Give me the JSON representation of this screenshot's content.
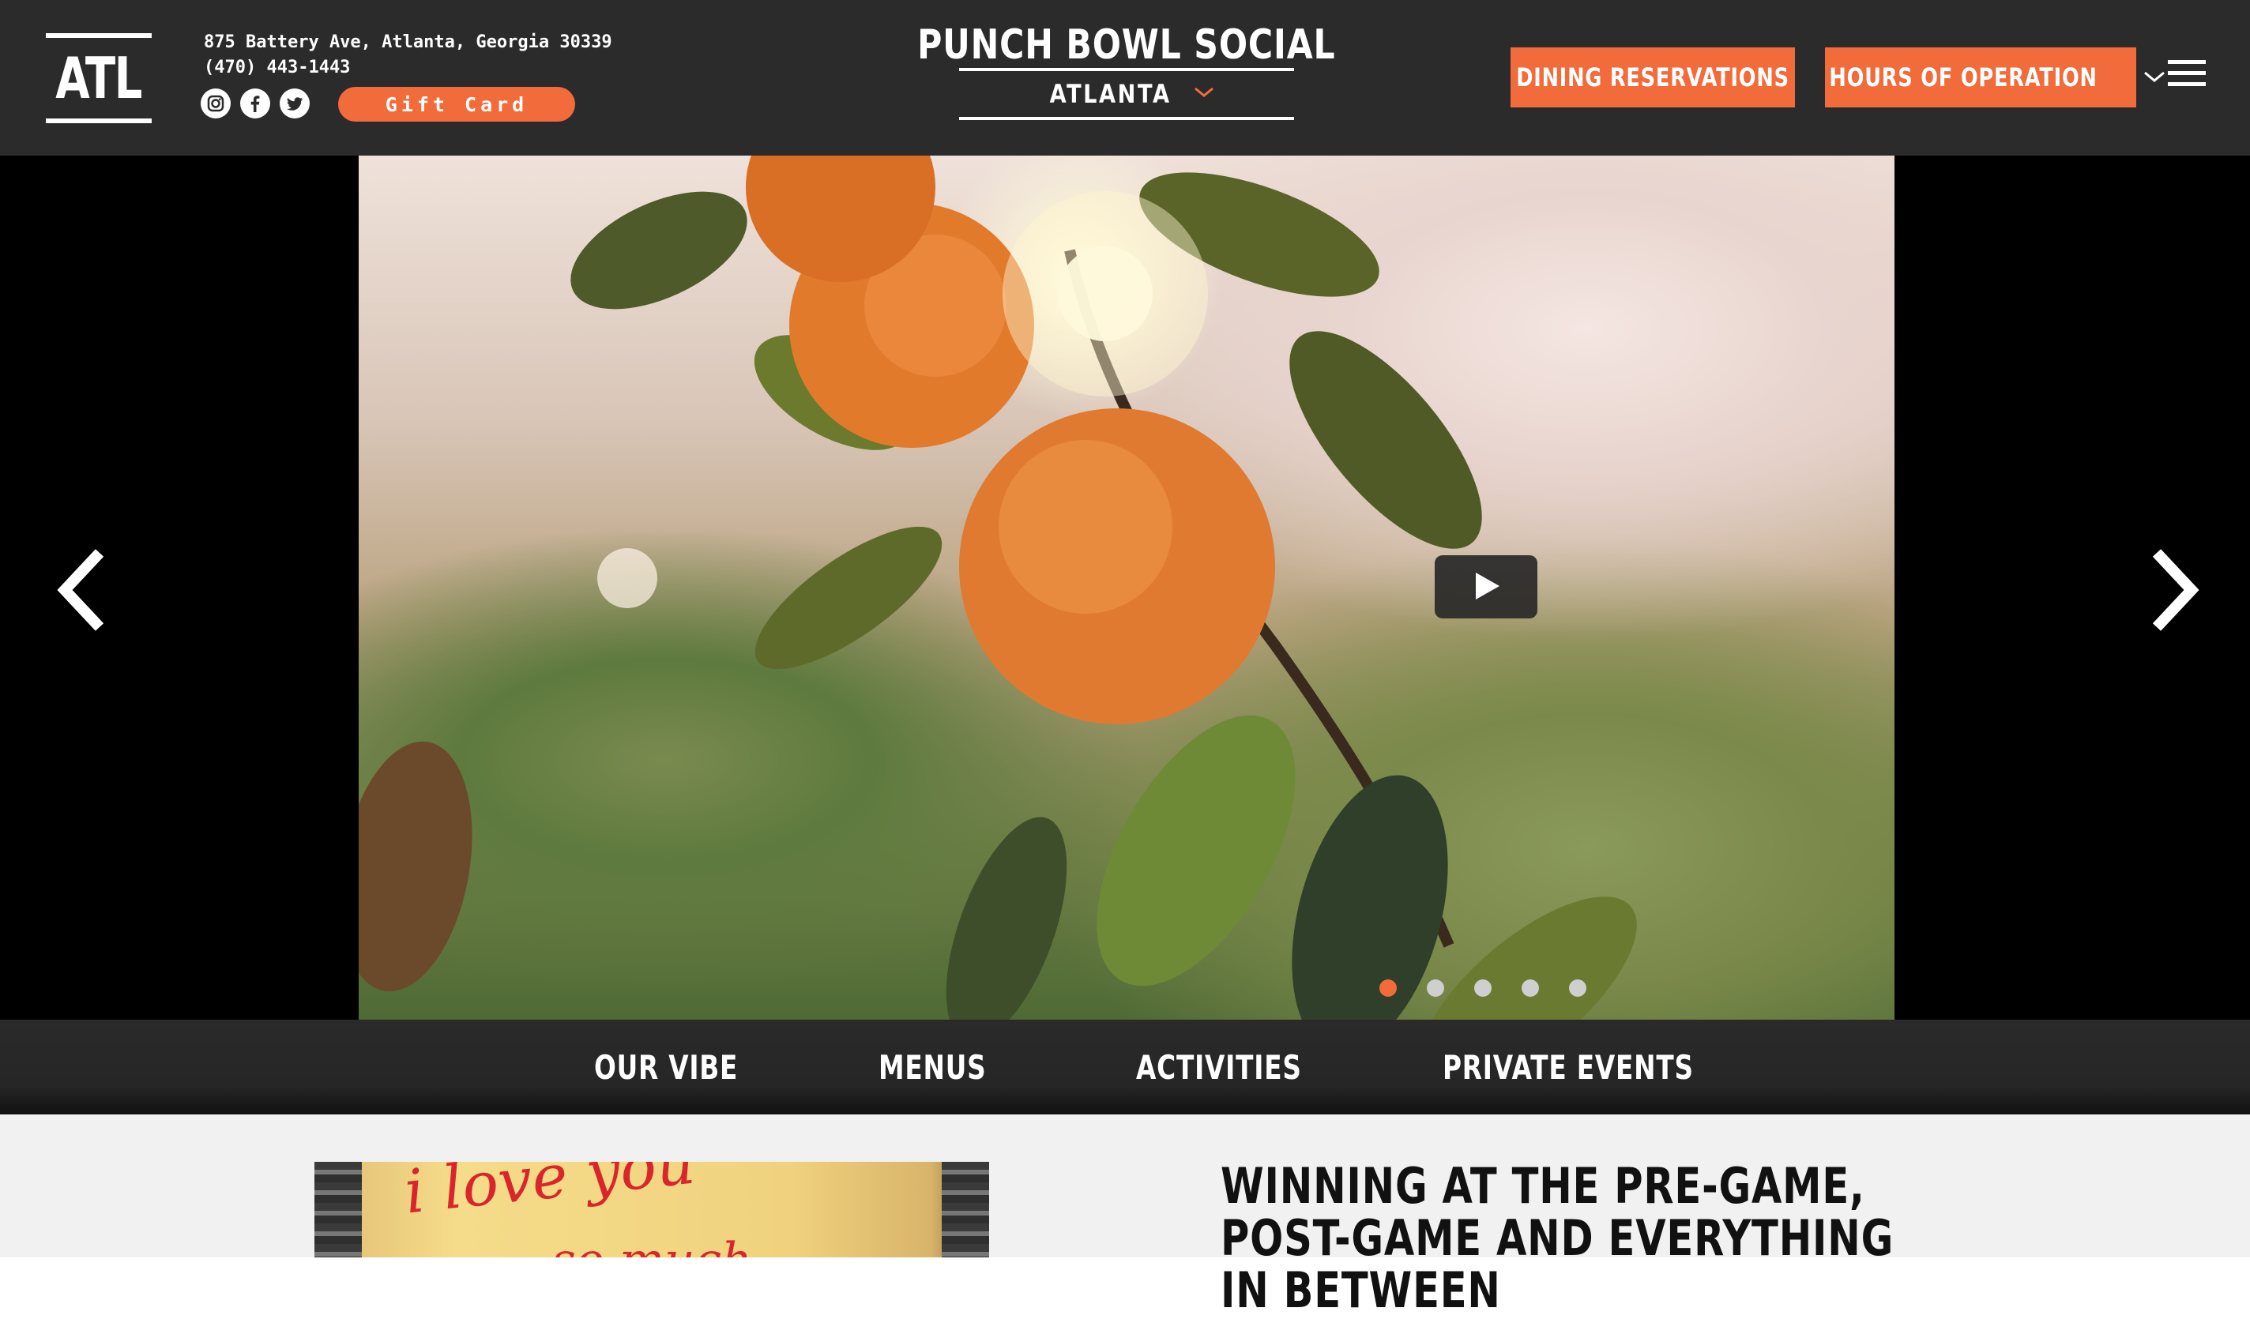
{
  "header": {
    "logo_text": "ATL",
    "address": "875 Battery Ave, Atlanta, Georgia 30339",
    "phone": "(470) 443-1443",
    "social_icons": [
      "instagram-icon",
      "facebook-icon",
      "twitter-icon"
    ],
    "gift_card_label": "Gift Card",
    "brand_name": "PUNCH BOWL SOCIAL",
    "city_label": "ATLANTA",
    "reservations_label": "DINING RESERVATIONS",
    "hours_label": "HOURS OF OPERATION",
    "accent_color": "#f26b3a",
    "bg_color": "#2b2b2b"
  },
  "hero": {
    "slide_count": 5,
    "active_slide": 1
  },
  "nav": {
    "items": [
      "OUR VIBE",
      "MENUS",
      "ACTIVITIES",
      "PRIVATE EVENTS"
    ]
  },
  "content": {
    "promo_text_line1": "i love you",
    "promo_text_line2": "so much",
    "headline": "WINNING AT THE PRE-GAME, POST-GAME AND EVERYTHING IN BETWEEN"
  }
}
